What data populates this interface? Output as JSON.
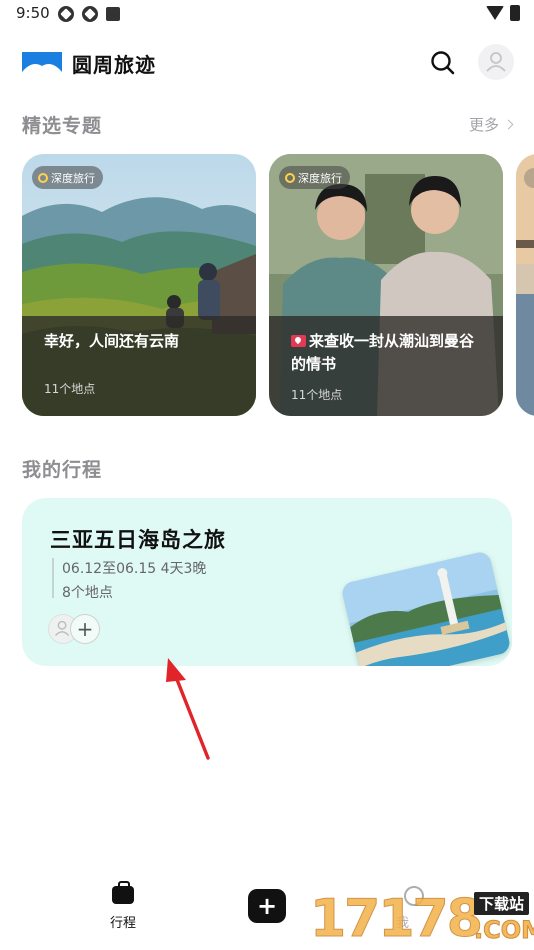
{
  "status_bar": {
    "time": "9:50"
  },
  "header": {
    "app_title": "圆周旅迹"
  },
  "featured": {
    "section_title": "精选专题",
    "more_label": "更多",
    "cards": [
      {
        "tag": "深度旅行",
        "title": "幸好，人间还有云南",
        "subtitle": "11个地点"
      },
      {
        "tag": "深度旅行",
        "title": "来查收一封从潮汕到曼谷的情书",
        "subtitle": "11个地点"
      }
    ]
  },
  "my_trips": {
    "section_title": "我的行程",
    "trip": {
      "title": "三亚五日海岛之旅",
      "dates": "06.12至06.15 4天3晚",
      "places": "8个地点"
    }
  },
  "bottom_nav": {
    "trip_label": "行程",
    "add_label": "+",
    "profile_label": "我"
  },
  "watermark": {
    "digits": "17178",
    "label": "下载站",
    "suffix": ".COM"
  },
  "colors": {
    "accent": "#1a7fe0",
    "trip_card_bg": "#dffaf4",
    "annotation_arrow": "#e0242a"
  }
}
